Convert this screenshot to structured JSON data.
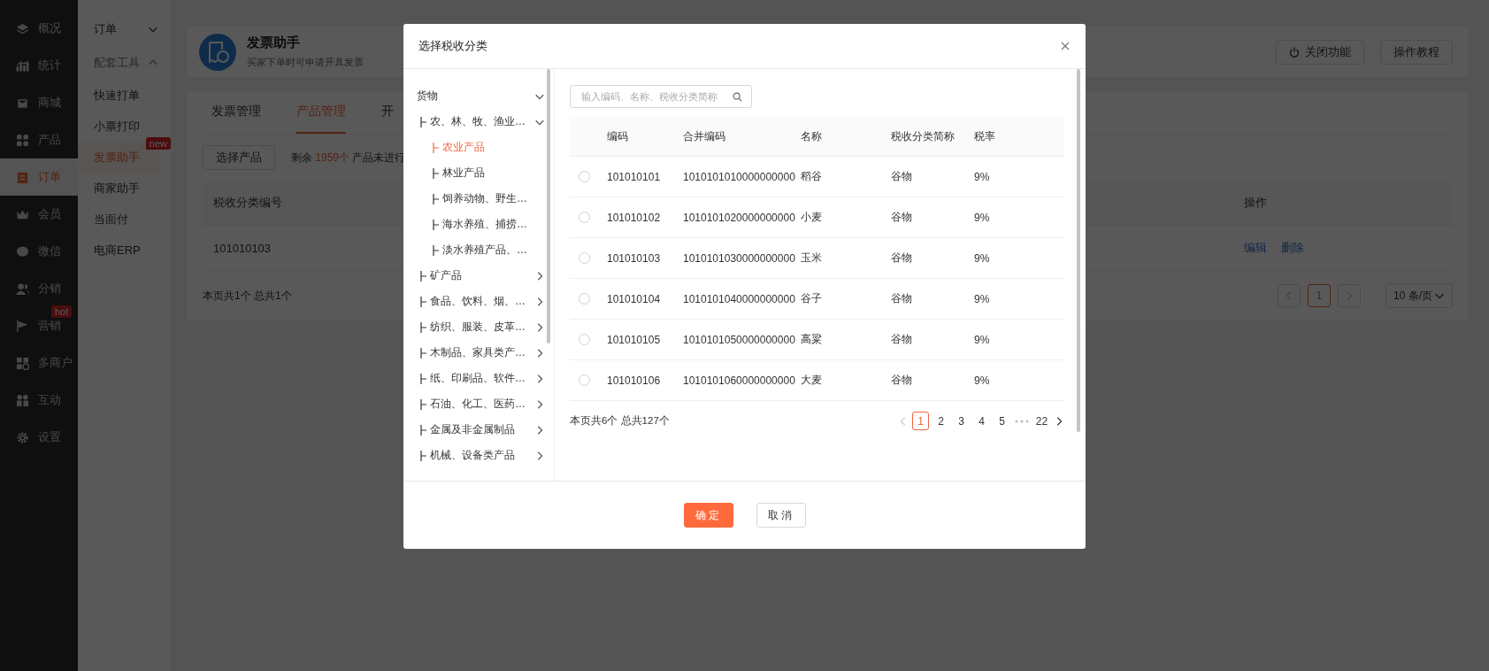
{
  "sidebar": {
    "items": [
      {
        "label": "概况",
        "selected": false
      },
      {
        "label": "统计",
        "selected": false
      },
      {
        "label": "商城",
        "selected": false
      },
      {
        "label": "产品",
        "selected": false
      },
      {
        "label": "订单",
        "selected": true
      },
      {
        "label": "会员",
        "selected": false
      },
      {
        "label": "微信",
        "selected": false
      },
      {
        "label": "分销",
        "selected": false
      },
      {
        "label": "营销",
        "selected": false,
        "badge": "hot"
      },
      {
        "label": "多商户",
        "selected": false
      },
      {
        "label": "互动",
        "selected": false
      },
      {
        "label": "设置",
        "selected": false
      }
    ]
  },
  "subnav": {
    "groups": [
      {
        "label": "订单",
        "expanded": false
      },
      {
        "label": "配套工具",
        "expanded": true,
        "children": [
          {
            "label": "快速打单",
            "selected": false
          },
          {
            "label": "小票打印",
            "selected": false
          },
          {
            "label": "发票助手",
            "selected": true,
            "badge": "new"
          },
          {
            "label": "商家助手",
            "selected": false
          },
          {
            "label": "当面付",
            "selected": false
          },
          {
            "label": "电商ERP",
            "selected": false
          }
        ]
      }
    ]
  },
  "header": {
    "title": "发票助手",
    "subtitle": "买家下单时可申请开具发票",
    "buttons": [
      {
        "label": "关闭功能",
        "kind": "iconed"
      },
      {
        "label": "操作教程",
        "kind": "plain"
      }
    ]
  },
  "tabs": [
    {
      "label": "发票管理",
      "selected": false
    },
    {
      "label": "产品管理",
      "selected": true
    },
    {
      "label": "开",
      "selected": false
    }
  ],
  "toolbar": {
    "button": "选择产品",
    "remaining_prefix": "剩余",
    "remaining_count": "1959个",
    "remaining_suffix": "产品未进行"
  },
  "table": {
    "columns": [
      "税收分类编号",
      "操作"
    ],
    "rows": [
      {
        "code": "101010103",
        "actions": [
          "编辑",
          "删除"
        ]
      }
    ]
  },
  "table_footer": {
    "summary": "本页共1个 总共1个",
    "prev": {
      "disabled": true
    },
    "pages": [
      {
        "label": "1",
        "selected": true
      }
    ],
    "next": {
      "disabled": true
    },
    "page_size": "10 条/页"
  },
  "modal": {
    "title": "选择税收分类",
    "tree": [
      {
        "label": "货物",
        "expanded": true,
        "selected": false,
        "children": [
          {
            "label": "农、林、牧、渔业…",
            "expanded": true,
            "selected": false,
            "children": [
              {
                "label": "农业产品",
                "selected": true
              },
              {
                "label": "林业产品",
                "selected": false
              },
              {
                "label": "饲养动物、野生…",
                "selected": false
              },
              {
                "label": "海水养殖、捕捞…",
                "selected": false
              },
              {
                "label": "淡水养殖产品、…",
                "selected": false
              }
            ]
          },
          {
            "label": "矿产品",
            "expanded": false,
            "selected": false
          },
          {
            "label": "食品、饮料、烟、…",
            "expanded": false,
            "selected": false
          },
          {
            "label": "纺织、服装、皮革…",
            "expanded": false,
            "selected": false
          },
          {
            "label": "木制品、家具类产…",
            "expanded": false,
            "selected": false
          },
          {
            "label": "纸、印刷品、软件…",
            "expanded": false,
            "selected": false
          },
          {
            "label": "石油、化工、医药…",
            "expanded": false,
            "selected": false
          },
          {
            "label": "金属及非金属制品",
            "expanded": false,
            "selected": false
          },
          {
            "label": "机械、设备类产品",
            "expanded": false,
            "selected": false
          }
        ]
      }
    ],
    "search": {
      "placeholder": "输入编码、名称、税收分类简称"
    },
    "columns": [
      "编码",
      "合并编码",
      "名称",
      "税收分类简称",
      "税率"
    ],
    "rows": [
      {
        "selected": false,
        "code": "101010101",
        "merged_code": "1010101010000000000",
        "name": "稻谷",
        "short_name": "谷物",
        "rate": "9%"
      },
      {
        "selected": false,
        "code": "101010102",
        "merged_code": "1010101020000000000",
        "name": "小麦",
        "short_name": "谷物",
        "rate": "9%"
      },
      {
        "selected": false,
        "code": "101010103",
        "merged_code": "1010101030000000000",
        "name": "玉米",
        "short_name": "谷物",
        "rate": "9%"
      },
      {
        "selected": false,
        "code": "101010104",
        "merged_code": "1010101040000000000",
        "name": "谷子",
        "short_name": "谷物",
        "rate": "9%"
      },
      {
        "selected": false,
        "code": "101010105",
        "merged_code": "1010101050000000000",
        "name": "高粱",
        "short_name": "谷物",
        "rate": "9%"
      },
      {
        "selected": false,
        "code": "101010106",
        "merged_code": "1010101060000000000",
        "name": "大麦",
        "short_name": "谷物",
        "rate": "9%"
      }
    ],
    "summary": "本页共6个 总共127个",
    "prev": {
      "disabled": true
    },
    "pages": [
      {
        "kind": "page",
        "label": "1",
        "selected": true
      },
      {
        "kind": "page",
        "label": "2",
        "selected": false
      },
      {
        "kind": "page",
        "label": "3",
        "selected": false
      },
      {
        "kind": "page",
        "label": "4",
        "selected": false
      },
      {
        "kind": "page",
        "label": "5",
        "selected": false
      },
      {
        "kind": "more"
      },
      {
        "kind": "page",
        "label": "22",
        "selected": false
      }
    ],
    "next": {
      "disabled": false
    },
    "buttons": [
      {
        "label": "确定",
        "kind": "primary"
      },
      {
        "label": "取消",
        "kind": "default"
      }
    ]
  }
}
